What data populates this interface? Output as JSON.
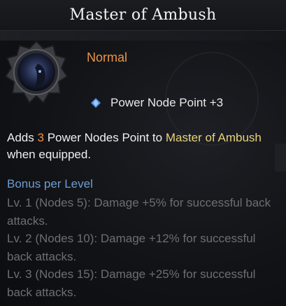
{
  "tooltip": {
    "title": "Master of Ambush",
    "grade": "Normal",
    "node_bonus": "Power Node Point +3",
    "description": {
      "prefix": "Adds",
      "amount": "3",
      "middle": "Power Nodes Point to",
      "target": "Master of Ambush",
      "suffix": "when equipped."
    },
    "bonus_header": "Bonus per Level",
    "bonus_levels": [
      "Lv. 1 (Nodes 5): Damage +5% for successful back attacks.",
      "Lv. 2 (Nodes 10): Damage +12% for successful back attacks.",
      "Lv. 3 (Nodes 15): Damage +25% for successful back attacks."
    ],
    "icons": {
      "engraving": "moon-hood-engraving-icon",
      "node": "blue-diamond-icon"
    },
    "colors": {
      "grade": "#ea9446",
      "highlight": "#e7d27a",
      "bonus_header": "#6f9ccf",
      "bonus_text": "#6e6e72"
    }
  }
}
